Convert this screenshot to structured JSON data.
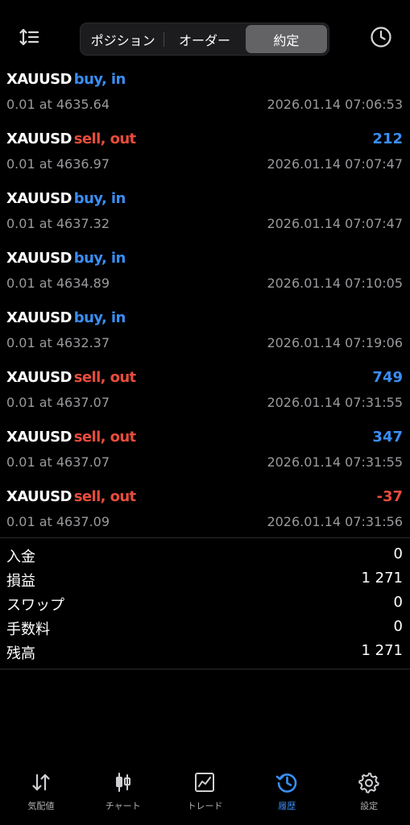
{
  "header": {
    "segments": [
      "ポジション",
      "オーダー",
      "約定"
    ],
    "active_segment": 2,
    "left_icon": "sort-icon",
    "right_icon": "clock-icon"
  },
  "deals": [
    {
      "symbol": "XAUUSD",
      "side": "buy, in",
      "direction": "buy",
      "profit": "",
      "volume_price": "0.01 at 4635.64",
      "time": "2026.01.14 07:06:53"
    },
    {
      "symbol": "XAUUSD",
      "side": "sell, out",
      "direction": "sell",
      "profit": "212",
      "volume_price": "0.01 at 4636.97",
      "time": "2026.01.14 07:07:47"
    },
    {
      "symbol": "XAUUSD",
      "side": "buy, in",
      "direction": "buy",
      "profit": "",
      "volume_price": "0.01 at 4637.32",
      "time": "2026.01.14 07:07:47"
    },
    {
      "symbol": "XAUUSD",
      "side": "buy, in",
      "direction": "buy",
      "profit": "",
      "volume_price": "0.01 at 4634.89",
      "time": "2026.01.14 07:10:05"
    },
    {
      "symbol": "XAUUSD",
      "side": "buy, in",
      "direction": "buy",
      "profit": "",
      "volume_price": "0.01 at 4632.37",
      "time": "2026.01.14 07:19:06"
    },
    {
      "symbol": "XAUUSD",
      "side": "sell, out",
      "direction": "sell",
      "profit": "749",
      "volume_price": "0.01 at 4637.07",
      "time": "2026.01.14 07:31:55"
    },
    {
      "symbol": "XAUUSD",
      "side": "sell, out",
      "direction": "sell",
      "profit": "347",
      "volume_price": "0.01 at 4637.07",
      "time": "2026.01.14 07:31:55"
    },
    {
      "symbol": "XAUUSD",
      "side": "sell, out",
      "direction": "sell",
      "profit": "-37",
      "volume_price": "0.01 at 4637.09",
      "time": "2026.01.14 07:31:56"
    }
  ],
  "summary": [
    {
      "label": "入金",
      "value": "0"
    },
    {
      "label": "損益",
      "value": "1 271"
    },
    {
      "label": "スワップ",
      "value": "0"
    },
    {
      "label": "手数料",
      "value": "0"
    },
    {
      "label": "残高",
      "value": "1 271"
    }
  ],
  "tabbar": {
    "items": [
      {
        "label": "気配値",
        "icon": "quotes-arrows-icon"
      },
      {
        "label": "チャート",
        "icon": "candlestick-chart-icon"
      },
      {
        "label": "トレード",
        "icon": "trade-chart-icon"
      },
      {
        "label": "履歴",
        "icon": "history-icon"
      },
      {
        "label": "設定",
        "icon": "settings-gear-icon"
      }
    ],
    "active_index": 3
  },
  "colors": {
    "buy": "#3a8ef6",
    "sell": "#e74c3c",
    "accent": "#3a8ef6",
    "background": "#000000",
    "muted_text": "#9a9a9e",
    "segment_active": "#636366"
  }
}
